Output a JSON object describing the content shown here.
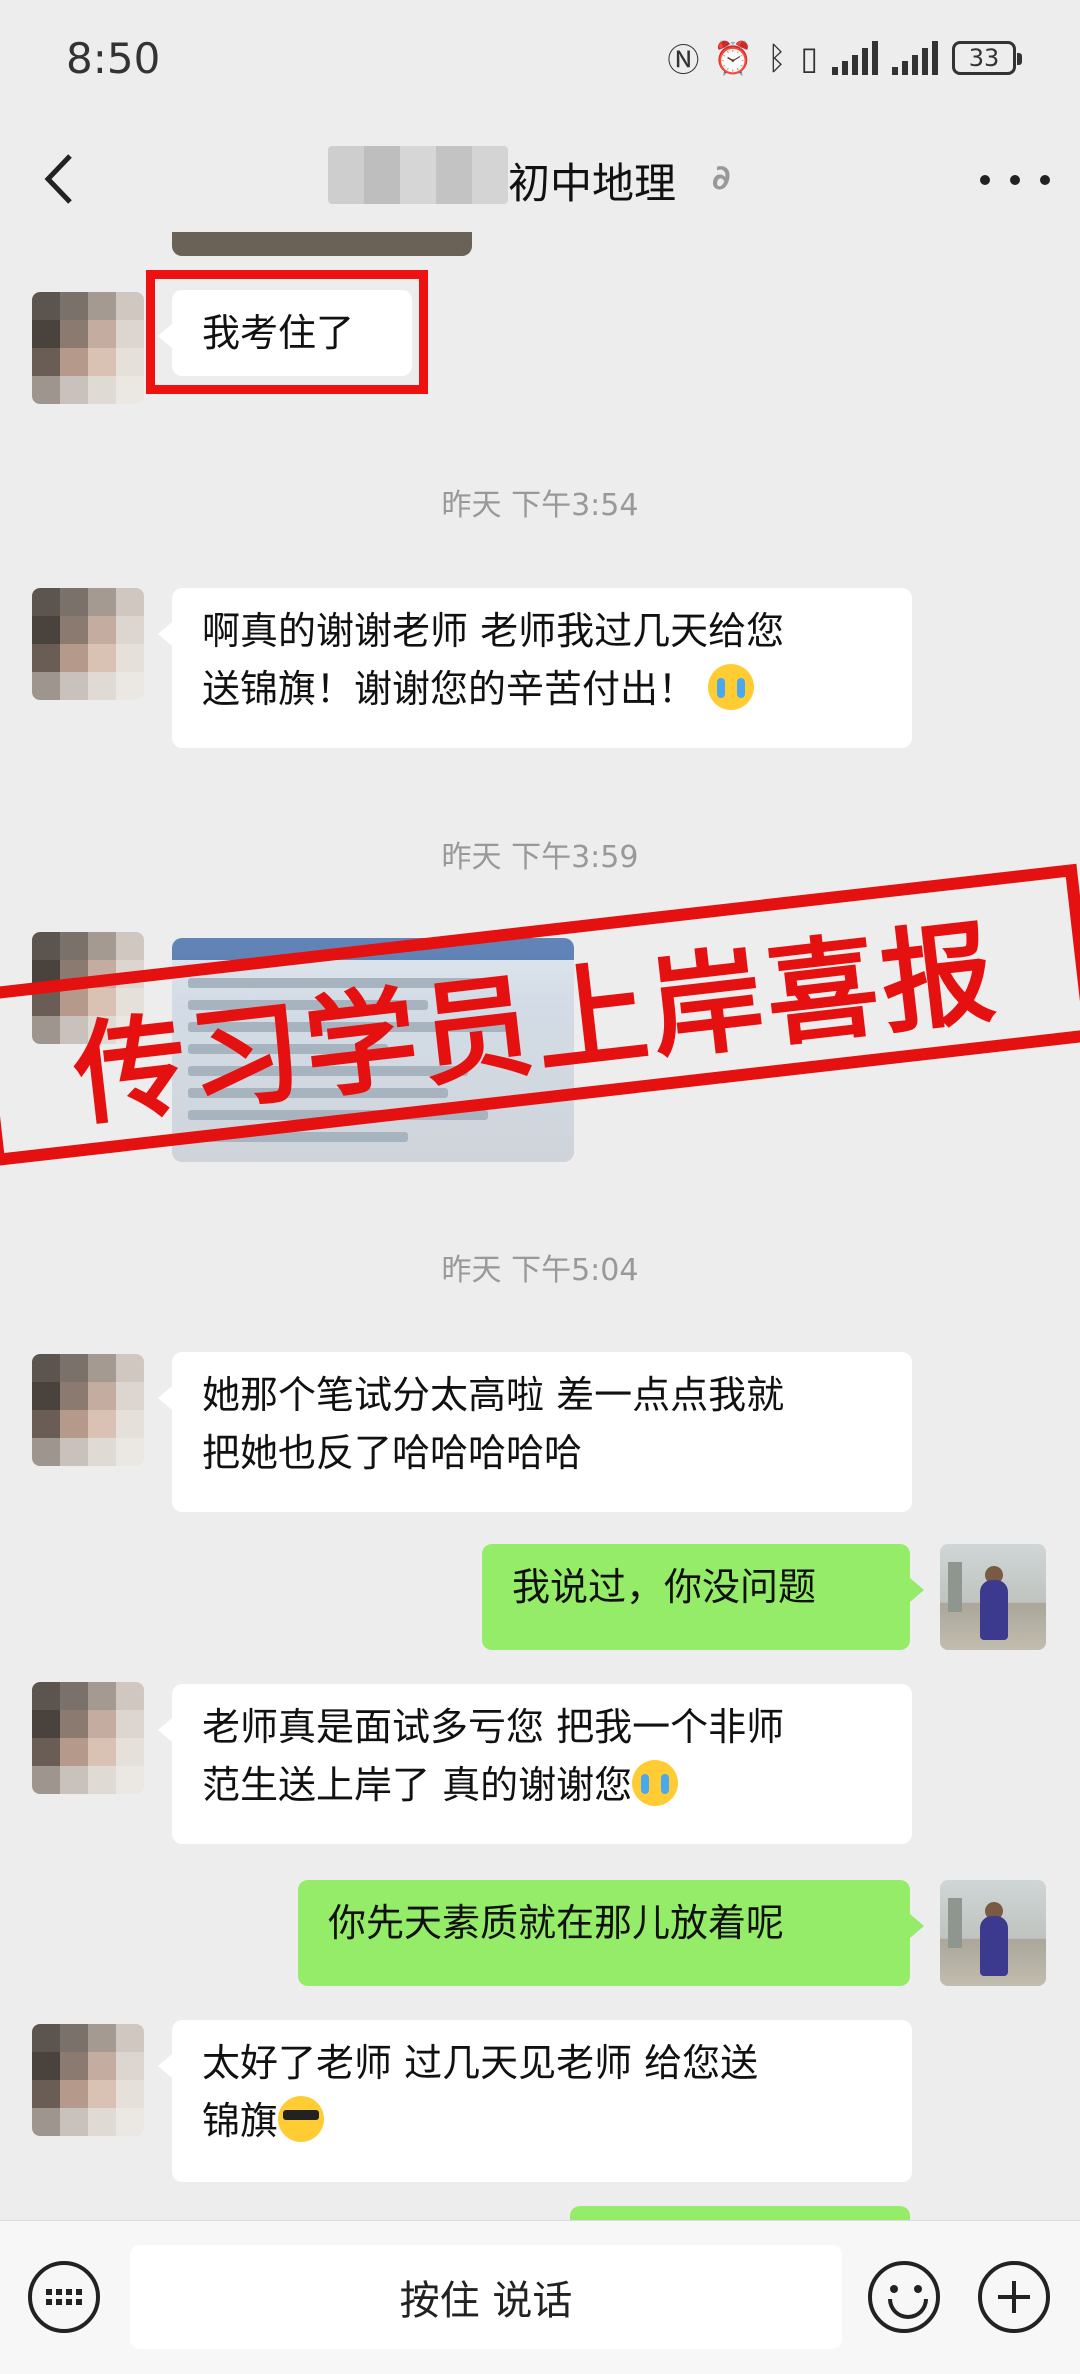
{
  "status_bar": {
    "time": "8:50",
    "battery": "33"
  },
  "header": {
    "title": "初中地理"
  },
  "timestamps": [
    "昨天 下午3:54",
    "昨天 下午3:59",
    "昨天 下午5:04"
  ],
  "messages": {
    "m1": "我考住了",
    "m2_line1": "啊真的谢谢老师 老师我过几天给您",
    "m2_line2": "送锦旗！谢谢您的辛苦付出！",
    "m3_line1": "她那个笔试分太高啦 差一点点我就",
    "m3_line2": "把她也反了哈哈哈哈哈",
    "m4": "我说过，你没问题",
    "m5_line1": "老师真是面试多亏您 把我一个非师",
    "m5_line2": "范生送上岸了 真的谢谢您",
    "m6": "你先天素质就在那儿放着呢",
    "m7_line1": "太好了老师 过几天见老师 给您送",
    "m7_line2": "锦旗"
  },
  "overlay": {
    "stamp_text": "传习学员上岸喜报",
    "stamp_color": "#e51010"
  },
  "bottom_bar": {
    "talk_label": "按住 说话"
  },
  "colors": {
    "background": "#ededed",
    "self_bubble": "#95ec69",
    "other_bubble": "#ffffff",
    "highlight": "#ee1111"
  }
}
